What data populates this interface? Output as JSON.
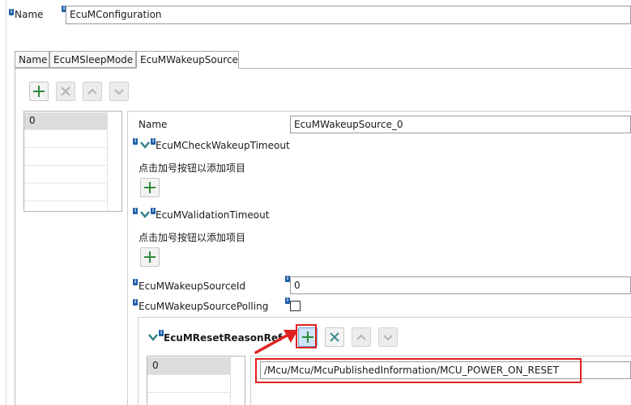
{
  "top": {
    "name_label": "Name",
    "name_value": "EcuMConfiguration"
  },
  "tabs": [
    "Name",
    "EcuMSleepMode",
    "EcuMWakeupSource"
  ],
  "left_list": {
    "items": [
      "0"
    ]
  },
  "form": {
    "name_label": "Name",
    "name_value": "EcuMWakeupSource_0",
    "check_timeout_label": "EcuMCheckWakeupTimeout",
    "check_timeout_hint": "点击加号按钮以添加项目",
    "validation_timeout_label": "EcuMValidationTimeout",
    "validation_timeout_hint": "点击加号按钮以添加项目",
    "source_id_label": "EcuMWakeupSourceId",
    "source_id_value": "0",
    "polling_label": "EcuMWakeupSourcePolling"
  },
  "reset_ref": {
    "label": "EcuMResetReasonRef",
    "list_items": [
      "0"
    ],
    "ref_value": "/Mcu/Mcu/McuPublishedInformation/MCU_POWER_ON_RESET"
  },
  "colors": {
    "add_green": "#2e8b3a",
    "remove_teal": "#3a8a8a",
    "highlight_red": "#e02020",
    "info_blue": "#1f5fa8"
  },
  "icons": [
    "info-icon",
    "add-icon",
    "remove-icon",
    "move-up-icon",
    "move-down-icon",
    "chevron-down-icon",
    "annotation-arrow-icon"
  ]
}
